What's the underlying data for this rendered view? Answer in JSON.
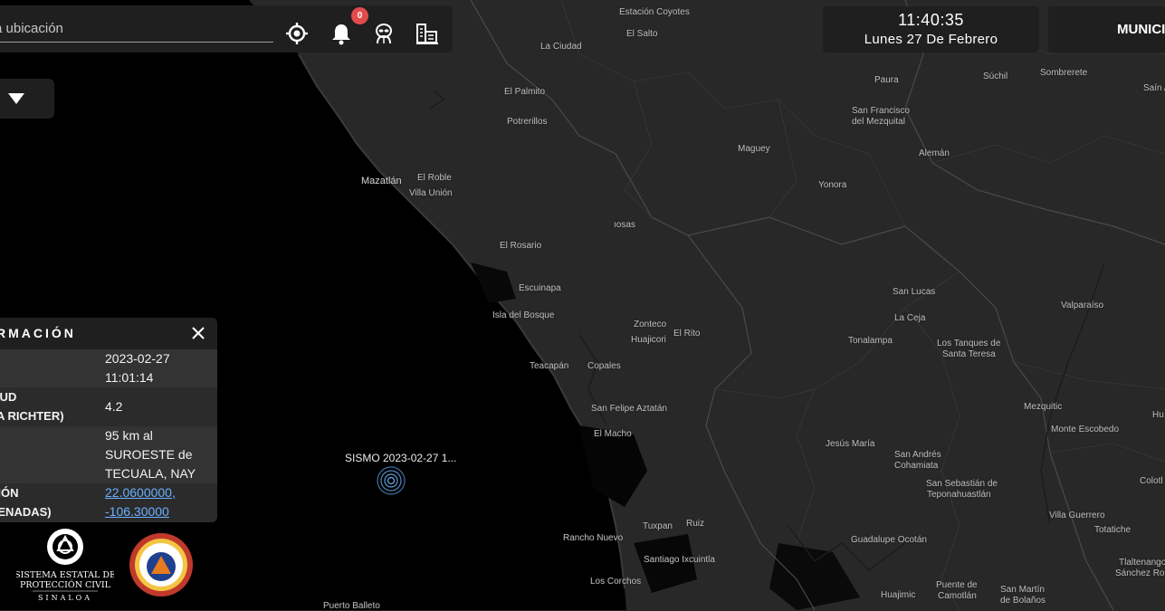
{
  "search": {
    "placeholder": "a ubicación"
  },
  "toolbar": {
    "locate_icon": "crosshair-icon",
    "alerts_icon": "bell-icon",
    "notifications_count": "0",
    "alien_icon": "alien-icon",
    "buildings_icon": "buildings-icon"
  },
  "clock": {
    "time": "11:40:35",
    "date": "Lunes 27 De Febrero"
  },
  "municipio": {
    "label": "MUNICI"
  },
  "info_panel": {
    "title": "RMACIÓN",
    "rows": [
      {
        "key": [
          "",
          ""
        ],
        "value": [
          "2023-02-27",
          "11:01:14"
        ]
      },
      {
        "key": [
          "ITUD",
          "LA RICHTER)"
        ],
        "value": [
          "4.2"
        ]
      },
      {
        "key": [
          "",
          ""
        ],
        "value": [
          "95 km al",
          "SUROESTE de",
          "TECUALA, NAY"
        ]
      },
      {
        "key": [
          "CIÓN",
          "DENADAS)"
        ],
        "value": [
          "22.0600000,",
          "-106.30000"
        ]
      }
    ]
  },
  "logos": {
    "sistema_lines": [
      "SISTEMA ESTATAL DE",
      "PROTECCIÓN CIVIL",
      "SINALOA"
    ]
  },
  "quake": {
    "label": "SISMO 2023-02-27 1..."
  },
  "places": [
    "Estación Coyotes",
    "El Salto",
    "La Ciudad",
    "El Palmito",
    "Potrerillos",
    "Mazatlán",
    "El Roble",
    "Villa Unión",
    "El Rosario",
    "Escuinapa",
    "Isla del Bosque",
    "Teacapán",
    "Copales",
    "Zonteco",
    "Huajicori",
    "El Rito",
    "San Felipe Aztatán",
    "El Macho",
    "Tuxpan",
    "Ruiz",
    "Rancho Nuevo",
    "Santiago Ixcuintla",
    "Los Corchos",
    "Puerto Balleto",
    "ıosas",
    "Sombrerete",
    "Súchil",
    "Paura",
    "San Francisco",
    "del Mezquital",
    "Maguey",
    "Alemán",
    "Yonora",
    "San Lucas",
    "La Ceja",
    "Tonalampa",
    "Los Tanques de",
    "Santa Teresa",
    "Valparaíso",
    "Mezquitic",
    "Monte Escobedo",
    "Jesús María",
    "San Andrés",
    "Cohamiata",
    "San Sebastián de",
    "Teponahuastlán",
    "Villa Guerrero",
    "Totatiche",
    "Guadalupe Ocotán",
    "Huajimic",
    "Puente de",
    "Camotlán",
    "San Martín",
    "de Bolaños",
    "Tlaltenango",
    "Sánchez Rom",
    "Saín A",
    "Hu",
    "Colotl"
  ]
}
